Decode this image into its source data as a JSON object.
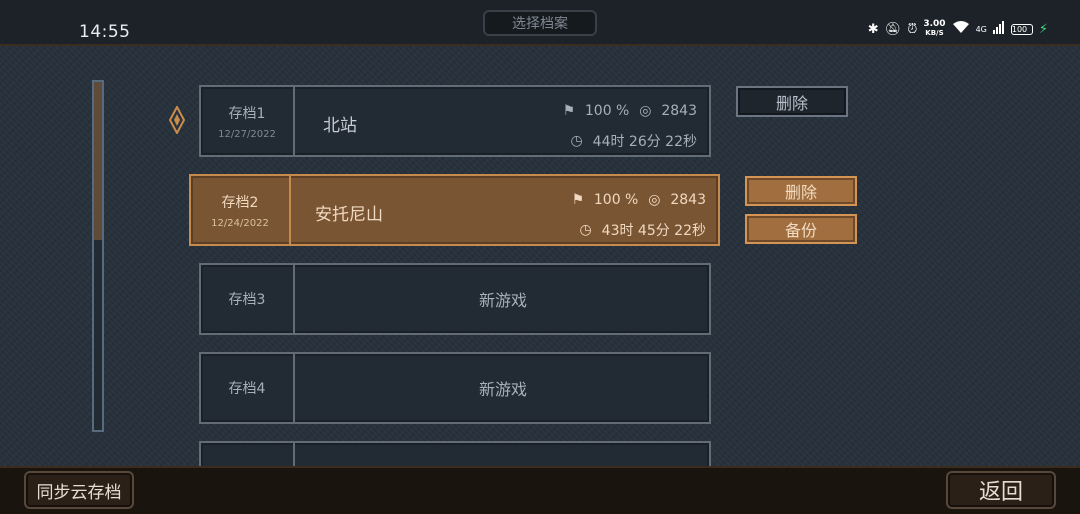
{
  "status_bar": {
    "time": "14:55",
    "net_speed": "3.00",
    "net_unit": "KB/S",
    "signal": "4G",
    "battery": "100"
  },
  "header": {
    "title": "选择档案"
  },
  "slots": [
    {
      "name": "存档1",
      "date": "12/27/2022",
      "location": "北站",
      "progress": "100 %",
      "coins": "2843",
      "playtime": "44时 26分 22秒"
    },
    {
      "name": "存档2",
      "date": "12/24/2022",
      "location": "安托尼山",
      "progress": "100 %",
      "coins": "2843",
      "playtime": "43时 45分 22秒"
    },
    {
      "name": "存档3",
      "status": "新游戏"
    },
    {
      "name": "存档4",
      "status": "新游戏"
    }
  ],
  "actions": {
    "slot1_delete": "删除",
    "slot2_delete": "删除",
    "slot2_backup": "备份"
  },
  "footer": {
    "sync_label": "同步云存档",
    "back_label": "返回"
  },
  "icons": {
    "selected_marker": "diamond-marker-icon",
    "progress": "flag-icon",
    "coins": "coin-icon",
    "playtime": "clock-icon"
  },
  "scroll": {
    "position_fraction": 0.45
  },
  "colors": {
    "background": "#27313b",
    "selected": "#7a5533",
    "accent": "#c98c4c"
  }
}
